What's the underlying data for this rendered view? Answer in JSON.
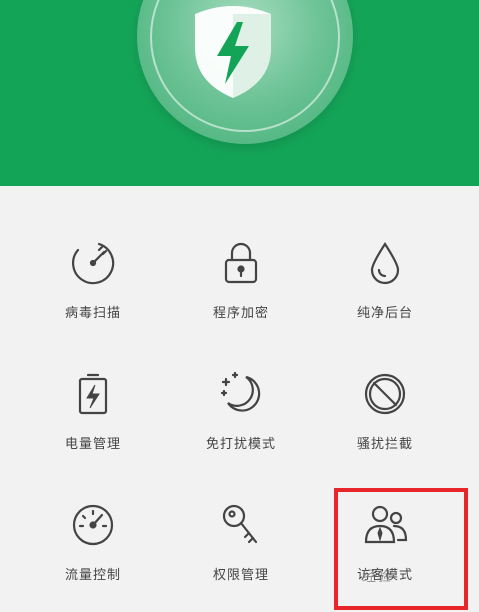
{
  "accent_color": "#14a458",
  "header": {
    "icon": "shield-lightning-icon"
  },
  "features": [
    {
      "label": "病毒扫描",
      "icon": "radar-scan-icon"
    },
    {
      "label": "程序加密",
      "icon": "lock-icon"
    },
    {
      "label": "纯净后台",
      "icon": "water-drop-icon"
    },
    {
      "label": "电量管理",
      "icon": "battery-bolt-icon"
    },
    {
      "label": "免打扰模式",
      "icon": "moon-stars-icon"
    },
    {
      "label": "骚扰拦截",
      "icon": "block-icon"
    },
    {
      "label": "流量控制",
      "icon": "speedometer-icon"
    },
    {
      "label": "权限管理",
      "icon": "key-icon"
    },
    {
      "label": "访客模式",
      "icon": "guest-users-icon"
    }
  ],
  "watermark": "经验"
}
